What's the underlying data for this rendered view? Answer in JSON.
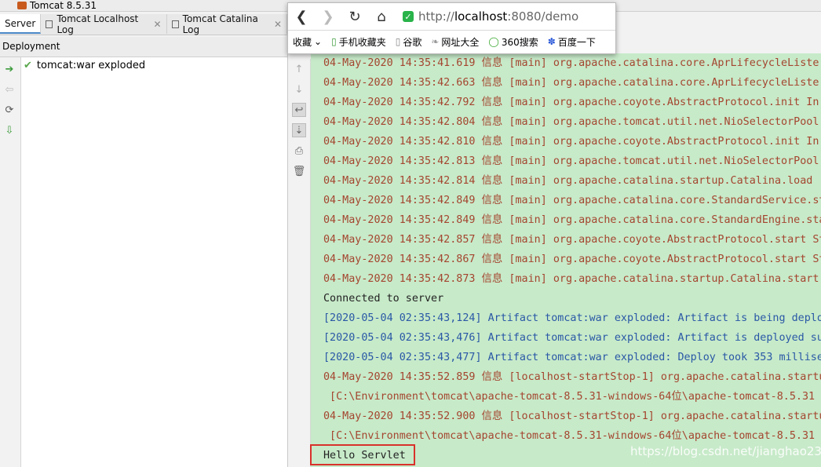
{
  "run_config": {
    "title": "Tomcat 8.5.31"
  },
  "tabs": [
    {
      "label": "Server",
      "active": true
    },
    {
      "label": "Tomcat Localhost Log"
    },
    {
      "label": "Tomcat Catalina Log"
    }
  ],
  "deployment": {
    "header": "Deployment",
    "items": [
      {
        "label": "tomcat:war exploded",
        "status": "check"
      }
    ]
  },
  "browser": {
    "url_prefix": "http://",
    "url_host": "localhost",
    "url_rest": ":8080/demo",
    "bookmarks": [
      {
        "label": "收藏",
        "icon": "chevron-down-icon"
      },
      {
        "label": "手机收藏夹",
        "icon": "phone-icon"
      },
      {
        "label": "谷歌",
        "icon": "page-icon"
      },
      {
        "label": "网址大全",
        "icon": "leaf-icon"
      },
      {
        "label": "360搜索",
        "icon": "circle-icon"
      },
      {
        "label": "百度一下",
        "icon": "paw-icon"
      }
    ]
  },
  "console": {
    "lines": [
      {
        "text": "04-May-2020 14:35:41.619 信息 [main] org.apache.catalina.core.AprLifecycleListe",
        "color": "red"
      },
      {
        "text": "04-May-2020 14:35:42.663 信息 [main] org.apache.catalina.core.AprLifecycleListe",
        "color": "red"
      },
      {
        "text": "04-May-2020 14:35:42.792 信息 [main] org.apache.coyote.AbstractProtocol.init In",
        "color": "red"
      },
      {
        "text": "04-May-2020 14:35:42.804 信息 [main] org.apache.tomcat.util.net.NioSelectorPool.",
        "color": "red"
      },
      {
        "text": "04-May-2020 14:35:42.810 信息 [main] org.apache.coyote.AbstractProtocol.init In",
        "color": "red"
      },
      {
        "text": "04-May-2020 14:35:42.813 信息 [main] org.apache.tomcat.util.net.NioSelectorPool.",
        "color": "red"
      },
      {
        "text": "04-May-2020 14:35:42.814 信息 [main] org.apache.catalina.startup.Catalina.load",
        "color": "red"
      },
      {
        "text": "04-May-2020 14:35:42.849 信息 [main] org.apache.catalina.core.StandardService.st",
        "color": "red"
      },
      {
        "text": "04-May-2020 14:35:42.849 信息 [main] org.apache.catalina.core.StandardEngine.sta",
        "color": "red"
      },
      {
        "text": "04-May-2020 14:35:42.857 信息 [main] org.apache.coyote.AbstractProtocol.start St",
        "color": "red"
      },
      {
        "text": "04-May-2020 14:35:42.867 信息 [main] org.apache.coyote.AbstractProtocol.start St",
        "color": "red"
      },
      {
        "text": "04-May-2020 14:35:42.873 信息 [main] org.apache.catalina.startup.Catalina.start",
        "color": "red"
      },
      {
        "text": "Connected to server",
        "color": "black"
      },
      {
        "text": "[2020-05-04 02:35:43,124] Artifact tomcat:war exploded: Artifact is being deplo",
        "color": "blue"
      },
      {
        "text": "[2020-05-04 02:35:43,476] Artifact tomcat:war exploded: Artifact is deployed su",
        "color": "blue"
      },
      {
        "text": "[2020-05-04 02:35:43,477] Artifact tomcat:war exploded: Deploy took 353 millise",
        "color": "blue"
      },
      {
        "text": "04-May-2020 14:35:52.859 信息 [localhost-startStop-1] org.apache.catalina.startu",
        "color": "red"
      },
      {
        "text": " [C:\\Environment\\tomcat\\apache-tomcat-8.5.31-windows-64位\\apache-tomcat-8.5.31",
        "color": "red"
      },
      {
        "text": "04-May-2020 14:35:52.900 信息 [localhost-startStop-1] org.apache.catalina.startu",
        "color": "red"
      },
      {
        "text": " [C:\\Environment\\tomcat\\apache-tomcat-8.5.31-windows-64位\\apache-tomcat-8.5.31",
        "color": "red"
      },
      {
        "text": "Hello Servlet",
        "color": "black"
      }
    ]
  },
  "watermark": "https://blog.csdn.net/jianghao233",
  "colors": {
    "console_bg": "#c7eac9",
    "info_red": "#a4452f",
    "artifact_blue": "#2a58a6",
    "highlight_box": "#d9312b"
  }
}
